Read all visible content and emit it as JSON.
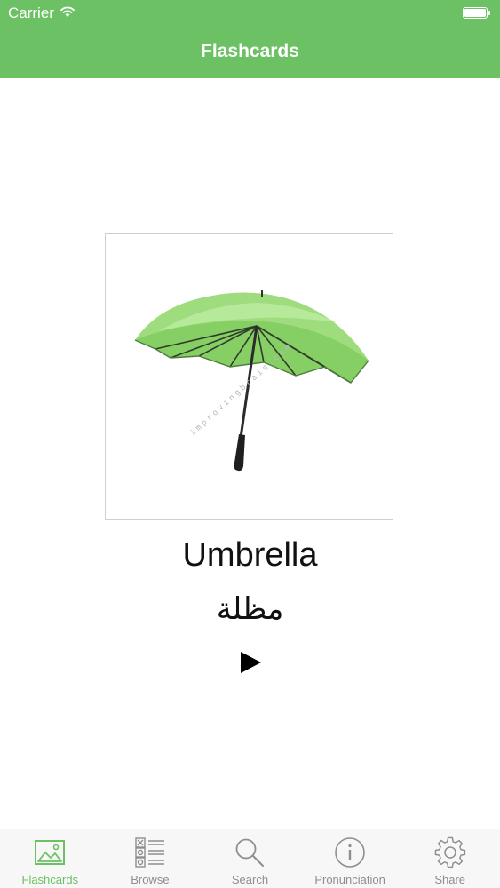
{
  "theme": {
    "accent": "#6cc164",
    "inactive": "#8e8e8e"
  },
  "status_bar": {
    "carrier": "Carrier",
    "wifi_icon": "wifi-icon",
    "battery_icon": "battery-icon"
  },
  "nav": {
    "title": "Flashcards"
  },
  "card": {
    "image_icon": "umbrella-picture",
    "watermark": "improvingbrain.com",
    "english": "Umbrella",
    "arabic": "مظلة",
    "play_icon": "play-icon"
  },
  "tabs": [
    {
      "label": "Flashcards",
      "icon": "picture-icon",
      "active": true
    },
    {
      "label": "Browse",
      "icon": "list-icon",
      "active": false
    },
    {
      "label": "Search",
      "icon": "search-icon",
      "active": false
    },
    {
      "label": "Pronunciation",
      "icon": "info-icon",
      "active": false
    },
    {
      "label": "Share",
      "icon": "gear-icon",
      "active": false
    }
  ]
}
